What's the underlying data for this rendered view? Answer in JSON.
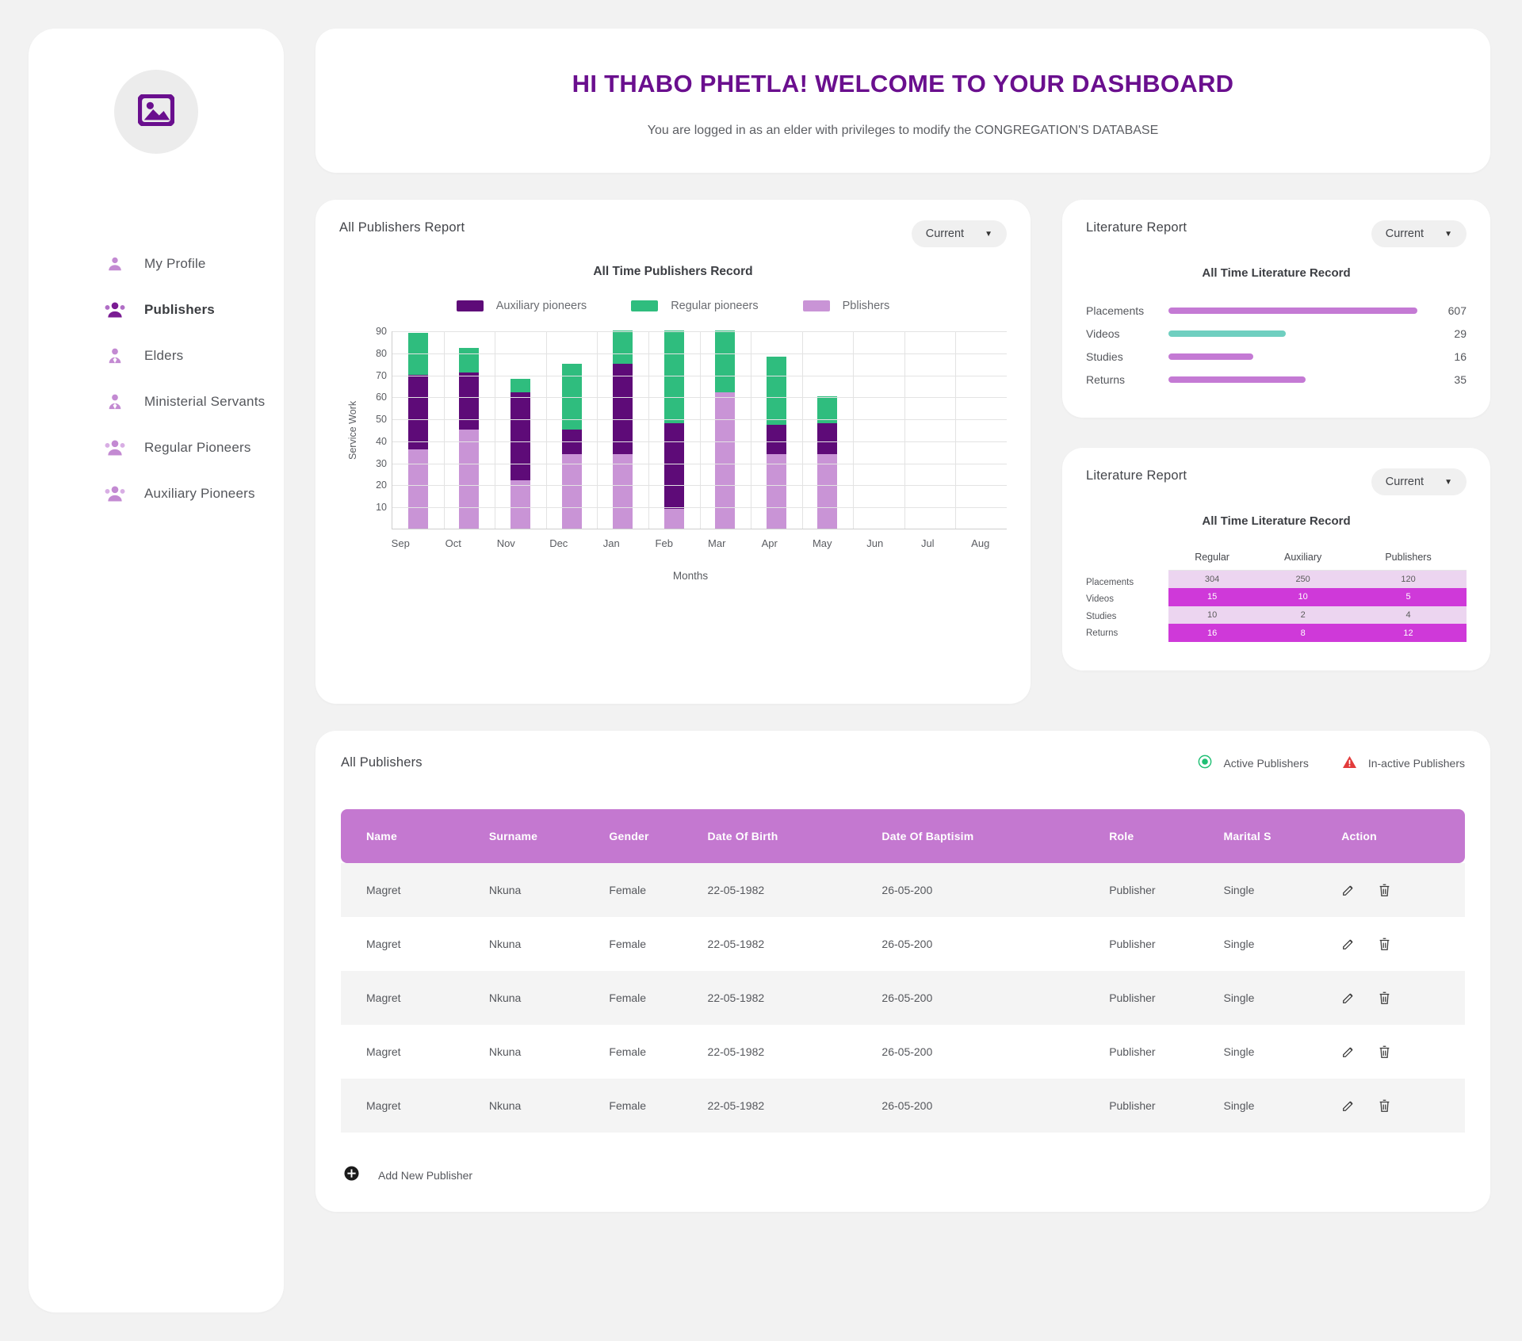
{
  "sidebar": {
    "avatar_icon": "image-placeholder-icon",
    "items": [
      {
        "label": "My Profile",
        "icon": "person-icon",
        "active": false
      },
      {
        "label": "Publishers",
        "icon": "group-icon",
        "active": true
      },
      {
        "label": "Elders",
        "icon": "person-tie-icon",
        "active": false
      },
      {
        "label": "Ministerial Servants",
        "icon": "person-tie-icon",
        "active": false
      },
      {
        "label": "Regular Pioneers",
        "icon": "group-icon",
        "active": false
      },
      {
        "label": "Auxiliary Pioneers",
        "icon": "group-icon",
        "active": false
      }
    ]
  },
  "welcome": {
    "title": "HI THABO PHETLA! WELCOME TO YOUR DASHBOARD",
    "subtitle": "You are logged in as an elder with privileges to modify the CONGREGATION'S DATABASE"
  },
  "publishers_report": {
    "title": "All Publishers Report",
    "filter_value": "Current",
    "caret_icon": "chevron-down-icon"
  },
  "literature_report_bars": {
    "title": "Literature Report",
    "filter_value": "Current",
    "caret_icon": "chevron-down-icon"
  },
  "literature_report_table": {
    "title": "Literature Report",
    "filter_value": "Current",
    "caret_icon": "chevron-down-icon"
  },
  "publishers_section": {
    "title": "All Publishers",
    "active_legend": "Active Publishers",
    "inactive_legend": "In-active Publishers",
    "active_icon": "active-dot-icon",
    "inactive_icon": "warning-triangle-icon",
    "add_label": "Add New Publisher",
    "add_icon": "plus-circle-icon",
    "edit_icon": "edit-pencil-icon",
    "delete_icon": "trash-icon",
    "columns": [
      "Name",
      "Surname",
      "Gender",
      "Date Of Birth",
      "Date Of Baptisim",
      "Role",
      "Marital S",
      "Action"
    ],
    "rows": [
      {
        "name": "Magret",
        "surname": "Nkuna",
        "gender": "Female",
        "dob": "22-05-1982",
        "dobap": "26-05-200",
        "role": "Publisher",
        "marital": "Single"
      },
      {
        "name": "Magret",
        "surname": "Nkuna",
        "gender": "Female",
        "dob": "22-05-1982",
        "dobap": "26-05-200",
        "role": "Publisher",
        "marital": "Single"
      },
      {
        "name": "Magret",
        "surname": "Nkuna",
        "gender": "Female",
        "dob": "22-05-1982",
        "dobap": "26-05-200",
        "role": "Publisher",
        "marital": "Single"
      },
      {
        "name": "Magret",
        "surname": "Nkuna",
        "gender": "Female",
        "dob": "22-05-1982",
        "dobap": "26-05-200",
        "role": "Publisher",
        "marital": "Single"
      },
      {
        "name": "Magret",
        "surname": "Nkuna",
        "gender": "Female",
        "dob": "22-05-1982",
        "dobap": "26-05-200",
        "role": "Publisher",
        "marital": "Single"
      }
    ]
  },
  "colors": {
    "brand_purple": "#6a0f8e",
    "auxiliary": "#5e0b78",
    "regular": "#2fbd7e",
    "publishers": "#c994d6",
    "table_header": "#c478d0",
    "teal": "#6fcfc0",
    "magenta_bright": "#cf39d9",
    "magenta_light": "#ecd5f0"
  },
  "chart_data": [
    {
      "type": "bar",
      "stacked": true,
      "title": "All Time Publishers Record",
      "xlabel": "Months",
      "ylabel": "Service Work",
      "ylim": [
        0,
        90
      ],
      "yticks": [
        10,
        20,
        30,
        40,
        50,
        60,
        70,
        80,
        90
      ],
      "grid": true,
      "legend_position": "top",
      "categories": [
        "Sep",
        "Oct",
        "Nov",
        "Dec",
        "Jan",
        "Feb",
        "Mar",
        "Apr",
        "May",
        "Jun",
        "Jul",
        "Aug"
      ],
      "series": [
        {
          "name": "Pblishers",
          "color": "#c994d6",
          "values": [
            36,
            45,
            22,
            34,
            34,
            9,
            62,
            34,
            34,
            0,
            0,
            0
          ]
        },
        {
          "name": "Auxiliary pioneers",
          "color": "#5e0b78",
          "values": [
            34,
            26,
            40,
            11,
            41,
            39,
            0,
            13,
            14,
            0,
            0,
            0
          ]
        },
        {
          "name": "Regular pioneers",
          "color": "#2fbd7e",
          "values": [
            19,
            11,
            6,
            30,
            15,
            42,
            28,
            31,
            12,
            0,
            0,
            0
          ]
        }
      ]
    },
    {
      "type": "bar",
      "orientation": "horizontal",
      "title": "All Time Literature  Record",
      "categories": [
        "Placements",
        "Videos",
        "Studies",
        "Returns"
      ],
      "values": [
        607,
        29,
        16,
        35
      ],
      "bar_colors": [
        "#c47ad4",
        "#6fcfc0",
        "#c47ad4",
        "#c47ad4"
      ],
      "bar_fractions": [
        1.0,
        0.47,
        0.34,
        0.55
      ]
    },
    {
      "type": "table",
      "title": "All Time Literature  Record",
      "row_labels": [
        "Placements",
        "Videos",
        "Studies",
        "Returns"
      ],
      "columns": [
        "Regular",
        "Auxiliary",
        "Publishers"
      ],
      "values": [
        [
          304,
          250,
          120
        ],
        [
          15,
          10,
          5
        ],
        [
          10,
          2,
          4
        ],
        [
          16,
          8,
          12
        ]
      ],
      "row_styles": [
        "light",
        "bright",
        "light",
        "bright"
      ]
    }
  ]
}
